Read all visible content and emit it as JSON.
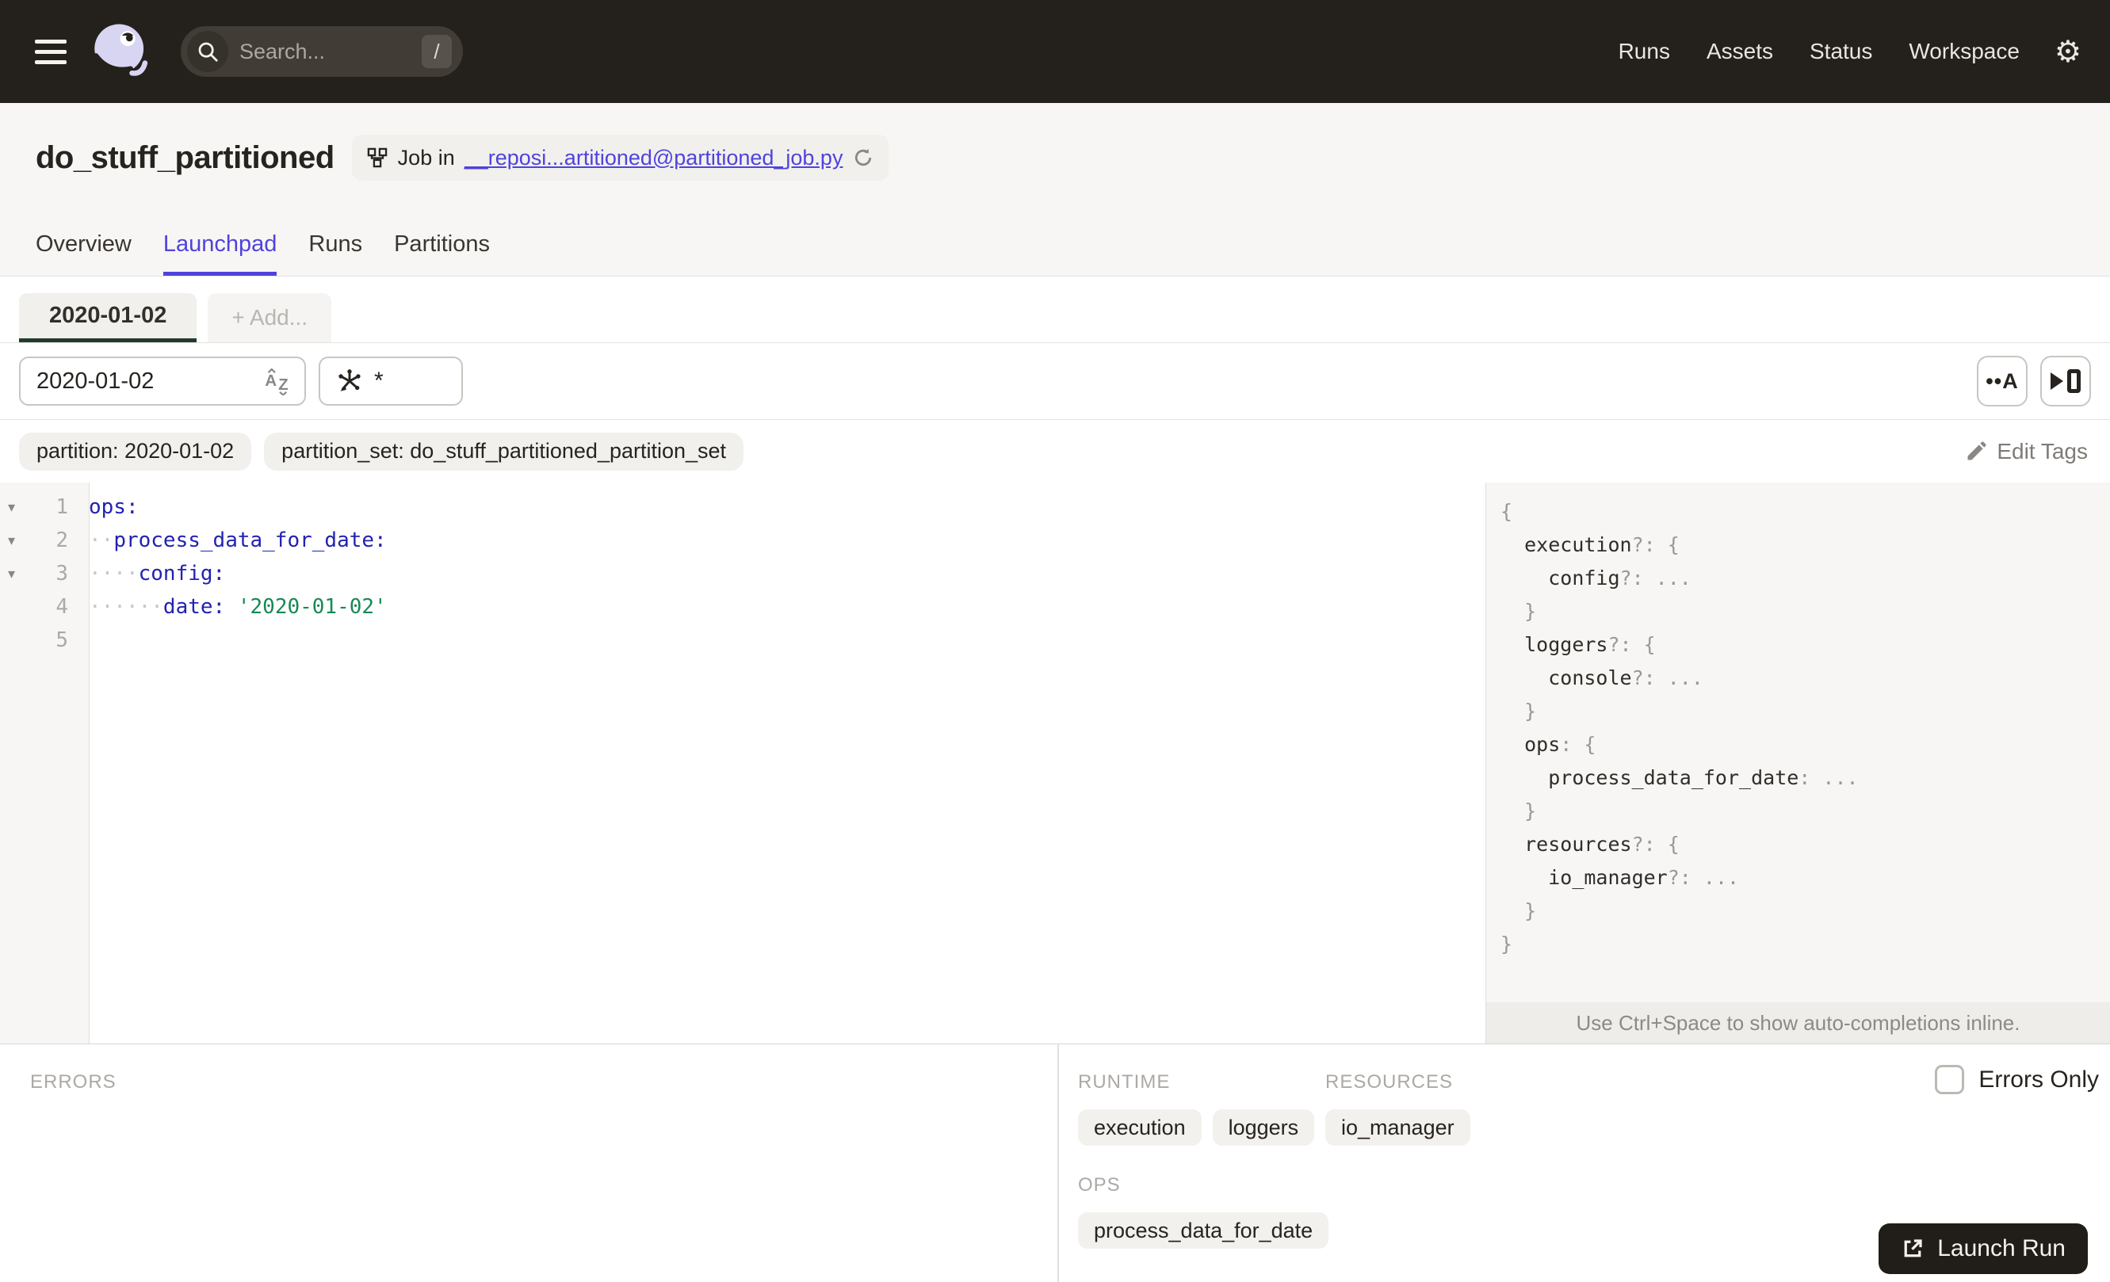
{
  "nav": {
    "search": {
      "placeholder": "Search...",
      "shortcut": "/"
    },
    "links": [
      "Runs",
      "Assets",
      "Status",
      "Workspace"
    ]
  },
  "header": {
    "title": "do_stuff_partitioned",
    "job_badge": {
      "prefix": "Job in",
      "link": "__reposi...artitioned@partitioned_job.py"
    },
    "tabs": [
      {
        "label": "Overview",
        "active": false
      },
      {
        "label": "Launchpad",
        "active": true
      },
      {
        "label": "Runs",
        "active": false
      },
      {
        "label": "Partitions",
        "active": false
      }
    ]
  },
  "launchpad": {
    "config_tab": "2020-01-02",
    "add_tab": "+ Add...",
    "partition_input": "2020-01-02",
    "op_selector": "*",
    "tags": [
      "partition: 2020-01-02",
      "partition_set: do_stuff_partitioned_partition_set"
    ],
    "edit_tags": "Edit Tags",
    "editor": {
      "lines": [
        {
          "num": 1,
          "fold": true,
          "indent": 0,
          "key": "ops:",
          "value": ""
        },
        {
          "num": 2,
          "fold": true,
          "indent": 2,
          "key": "process_data_for_date:",
          "value": ""
        },
        {
          "num": 3,
          "fold": true,
          "indent": 4,
          "key": "config:",
          "value": ""
        },
        {
          "num": 4,
          "fold": false,
          "indent": 6,
          "key": "date:",
          "value": "'2020-01-02'"
        },
        {
          "num": 5,
          "fold": false,
          "indent": 0,
          "key": "",
          "value": ""
        }
      ]
    },
    "schema": {
      "lines": [
        {
          "indent": 0,
          "key": "",
          "punct": "{"
        },
        {
          "indent": 1,
          "key": "execution",
          "punct": "?: {"
        },
        {
          "indent": 2,
          "key": "config",
          "punct": "?: ..."
        },
        {
          "indent": 1,
          "key": "",
          "punct": "}"
        },
        {
          "indent": 1,
          "key": "loggers",
          "punct": "?: {"
        },
        {
          "indent": 2,
          "key": "console",
          "punct": "?: ..."
        },
        {
          "indent": 1,
          "key": "",
          "punct": "}"
        },
        {
          "indent": 1,
          "key": "ops",
          "punct": ": {"
        },
        {
          "indent": 2,
          "key": "process_data_for_date",
          "punct": ": ..."
        },
        {
          "indent": 1,
          "key": "",
          "punct": "}"
        },
        {
          "indent": 1,
          "key": "resources",
          "punct": "?: {"
        },
        {
          "indent": 2,
          "key": "io_manager",
          "punct": "?: ..."
        },
        {
          "indent": 1,
          "key": "",
          "punct": "}"
        },
        {
          "indent": 0,
          "key": "",
          "punct": "}"
        }
      ]
    },
    "hint": "Use Ctrl+Space to show auto-completions inline."
  },
  "bottom": {
    "errors_label": "ERRORS",
    "errors_only": "Errors Only",
    "runtime_label": "RUNTIME",
    "resources_label": "RESOURCES",
    "ops_label": "OPS",
    "runtime_chips": [
      "execution",
      "loggers"
    ],
    "resources_chips": [
      "io_manager"
    ],
    "ops_chips": [
      "process_data_for_date"
    ],
    "launch_button": "Launch Run"
  },
  "colors": {
    "nav_bg": "#24201C",
    "accent_blue": "#4F43DD",
    "active_tab_underline": "#233B2E",
    "yaml_key": "#2222B2",
    "yaml_string": "#168A52",
    "panel_bg": "#F7F6F4"
  }
}
